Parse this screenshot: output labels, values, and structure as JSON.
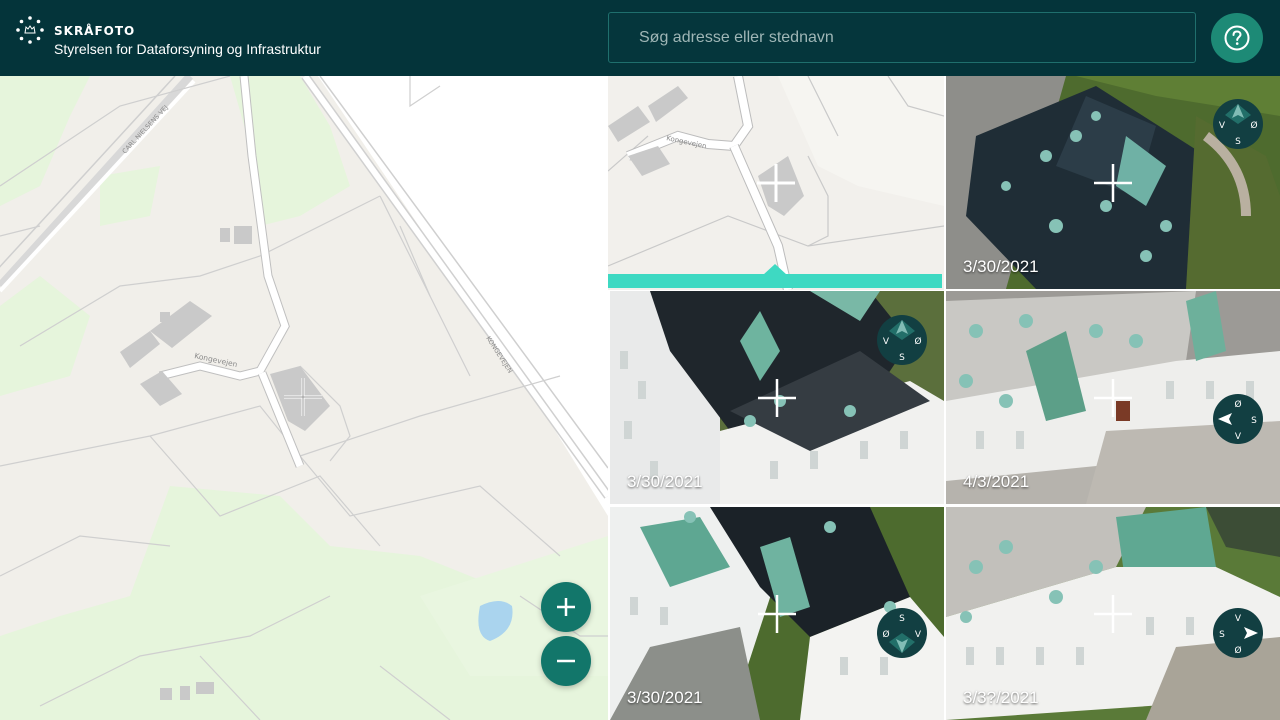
{
  "header": {
    "brand": "SKRÅFOTO",
    "org": "Styrelsen for Dataforsyning og Infrastruktur",
    "logo_icon": "crown-dots-icon",
    "help_icon": "question-icon"
  },
  "search": {
    "placeholder": "Søg adresse eller stednavn",
    "value": ""
  },
  "map": {
    "street_labels": [
      "CARL NIELSENS VEJ",
      "Kongevejen",
      "KONGEVEJEN"
    ],
    "zoom_in": "+",
    "zoom_out": "−"
  },
  "tiles": [
    {
      "kind": "map-preview",
      "date": "",
      "street_label": "Kongevejen",
      "active": true
    },
    {
      "kind": "photo",
      "date": "3/30/2021",
      "compass": {
        "n": "",
        "w": "V",
        "e": "Ø",
        "s": "S"
      }
    },
    {
      "kind": "photo",
      "date": "3/30/2021",
      "compass": {
        "n": "",
        "w": "V",
        "e": "Ø",
        "s": "S"
      }
    },
    {
      "kind": "photo",
      "date": "4/3/2021",
      "compass": {
        "n": "",
        "w": "V",
        "e": "Ø",
        "s": "S"
      }
    },
    {
      "kind": "photo",
      "date": "3/30/2021",
      "compass": {
        "n": "S",
        "w": "Ø",
        "e": "V",
        "s": ""
      }
    },
    {
      "kind": "photo",
      "date": "3/3?/2021",
      "compass": {
        "n": "V",
        "w": "S",
        "e": "",
        "s": "Ø"
      }
    }
  ],
  "colors": {
    "header_bg": "#04343a",
    "accent": "#3ed9c2",
    "button_teal": "#12766a",
    "compass_dark": "#123f42"
  }
}
